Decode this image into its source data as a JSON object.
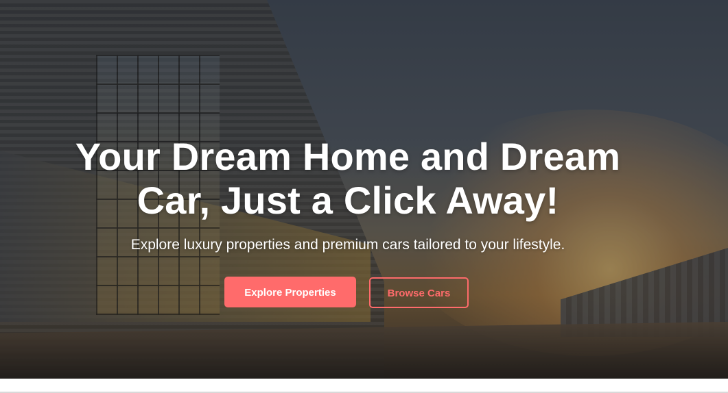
{
  "hero": {
    "headline": "Your Dream Home and Dream Car, Just a Click Away!",
    "subheadline": "Explore luxury properties and premium cars tailored to your lifestyle.",
    "primary_button": "Explore Properties",
    "secondary_button": "Browse Cars",
    "background_image": "warehouse-sunset-photo"
  },
  "colors": {
    "accent": "#ff6b6b",
    "text": "#ffffff",
    "page_background": "#ffffff"
  }
}
